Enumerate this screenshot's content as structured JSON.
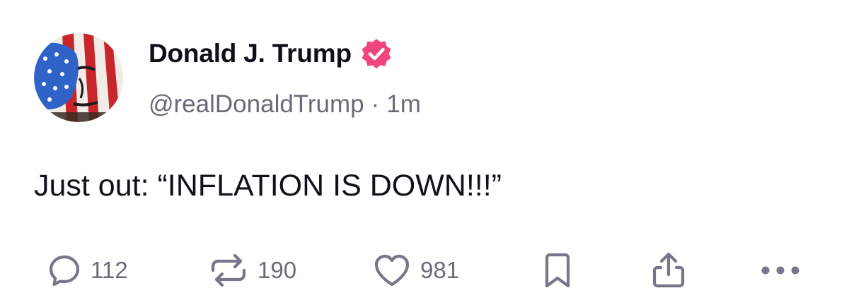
{
  "post": {
    "author": {
      "display_name": "Donald J. Trump",
      "handle": "@realDonaldTrump",
      "verified": true,
      "avatar_icon": "flag-painted-portrait-avatar"
    },
    "separator": "·",
    "time_ago": "1m",
    "text": "Just out: “INFLATION IS DOWN!!!”",
    "actions": {
      "reply": {
        "icon": "reply-bubble-icon",
        "count": "112"
      },
      "repost": {
        "icon": "repost-arrows-icon",
        "count": "190"
      },
      "like": {
        "icon": "heart-icon",
        "count": "981"
      },
      "bookmark": {
        "icon": "bookmark-icon"
      },
      "share": {
        "icon": "share-upload-icon"
      },
      "more": {
        "icon": "more-dots-icon"
      }
    }
  },
  "colors": {
    "text_primary": "#0f0f1a",
    "text_secondary": "#6b6a78",
    "icon_gray": "#77768a",
    "verified_badge": "#f0457a"
  }
}
